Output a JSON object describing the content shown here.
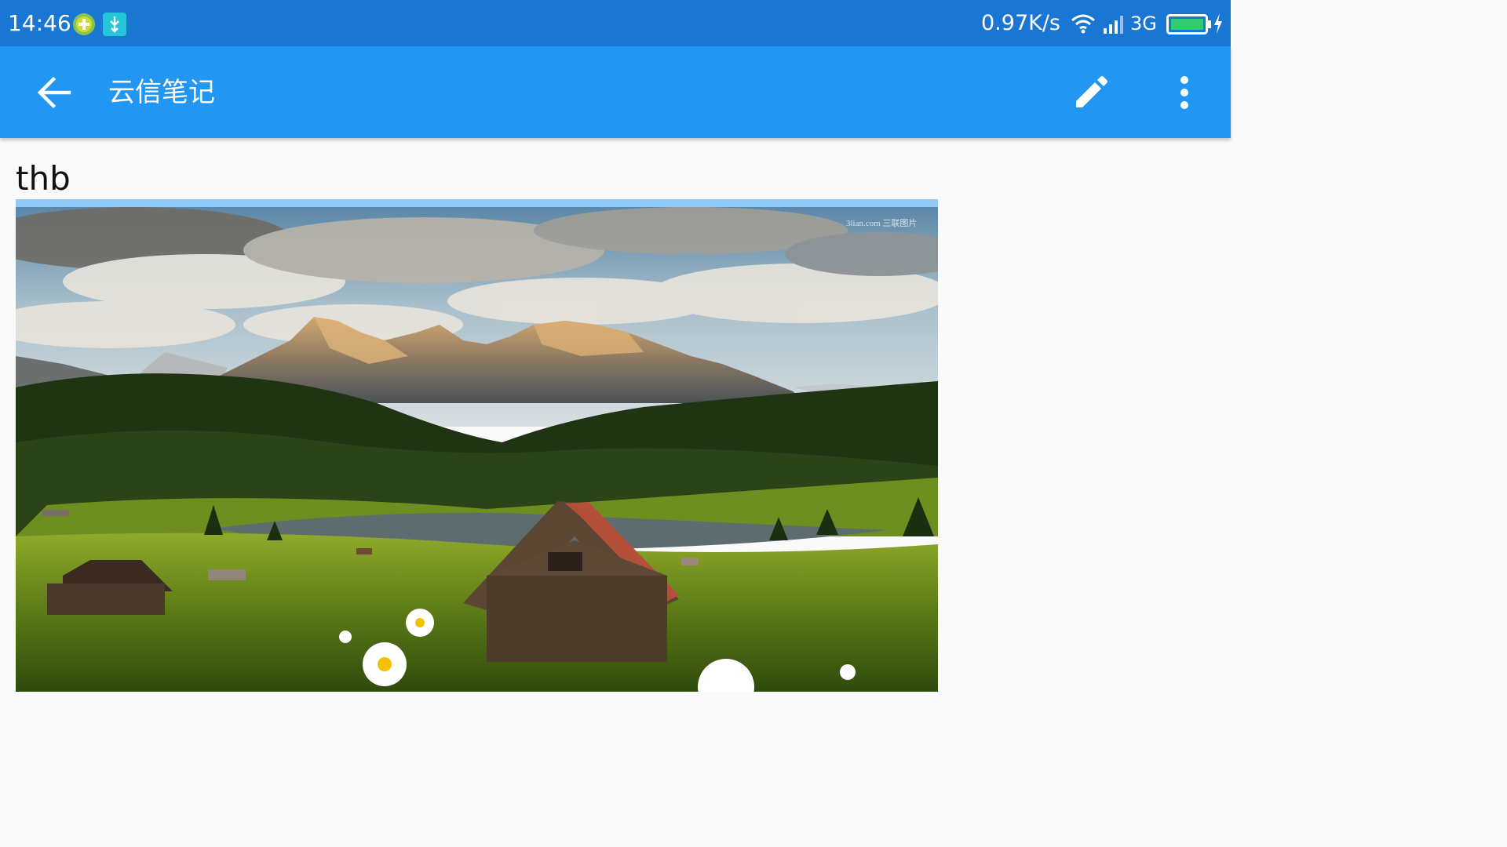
{
  "status_bar": {
    "time": "14:46",
    "app_icons": [
      "plus-circle-icon",
      "usb-icon"
    ],
    "net_speed": "0.97K/s",
    "network_type": "3G",
    "icons": [
      "wifi-icon",
      "signal-icon",
      "battery-icon",
      "charging-icon"
    ]
  },
  "app_bar": {
    "title": "云信笔记",
    "back_icon": "arrow-back-icon",
    "edit_icon": "pencil-icon",
    "menu_icon": "more-vert-icon"
  },
  "note": {
    "title": "thb",
    "image_watermark": "3lian.com 三联图片"
  },
  "colors": {
    "status_bar": "#1976d2",
    "app_bar": "#2196f3",
    "background": "#fafafa",
    "battery": "#2ecc71"
  }
}
